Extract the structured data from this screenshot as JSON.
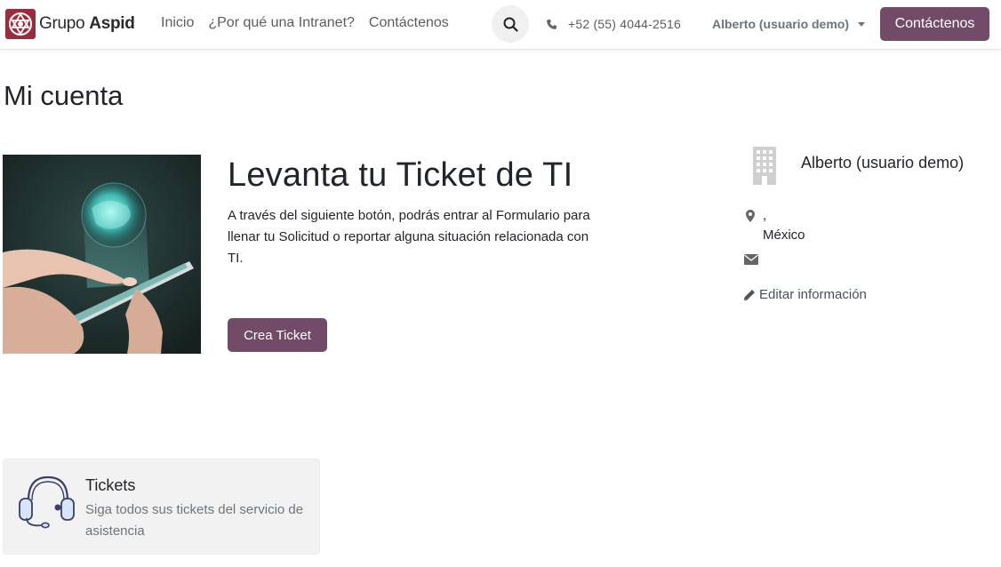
{
  "header": {
    "logo_prefix": "Grupo ",
    "logo_bold": "Aspid",
    "nav": [
      "Inicio",
      "¿Por qué una Intranet?",
      "Contáctenos"
    ],
    "phone": "+52 (55) 4044-2516",
    "user": "Alberto (usuario demo)",
    "cta_label": "Contáctenos",
    "accent_color": "#714b67"
  },
  "main": {
    "page_title": "Mi cuenta",
    "hero_title": "Levanta tu Ticket de TI",
    "hero_description": "A través del siguiente botón, podrás entrar al Formulario para llenar tu Solicitud o reportar alguna situación relacionada con TI.",
    "ticket_button": "Crea Ticket"
  },
  "profile": {
    "name": "Alberto (usuario demo)",
    "address_line1": ",",
    "address_line2": "México",
    "edit_label": "Editar información"
  },
  "cards": {
    "tickets_title": "Tickets",
    "tickets_description": "Siga todos sus tickets del servicio de asistencia"
  }
}
